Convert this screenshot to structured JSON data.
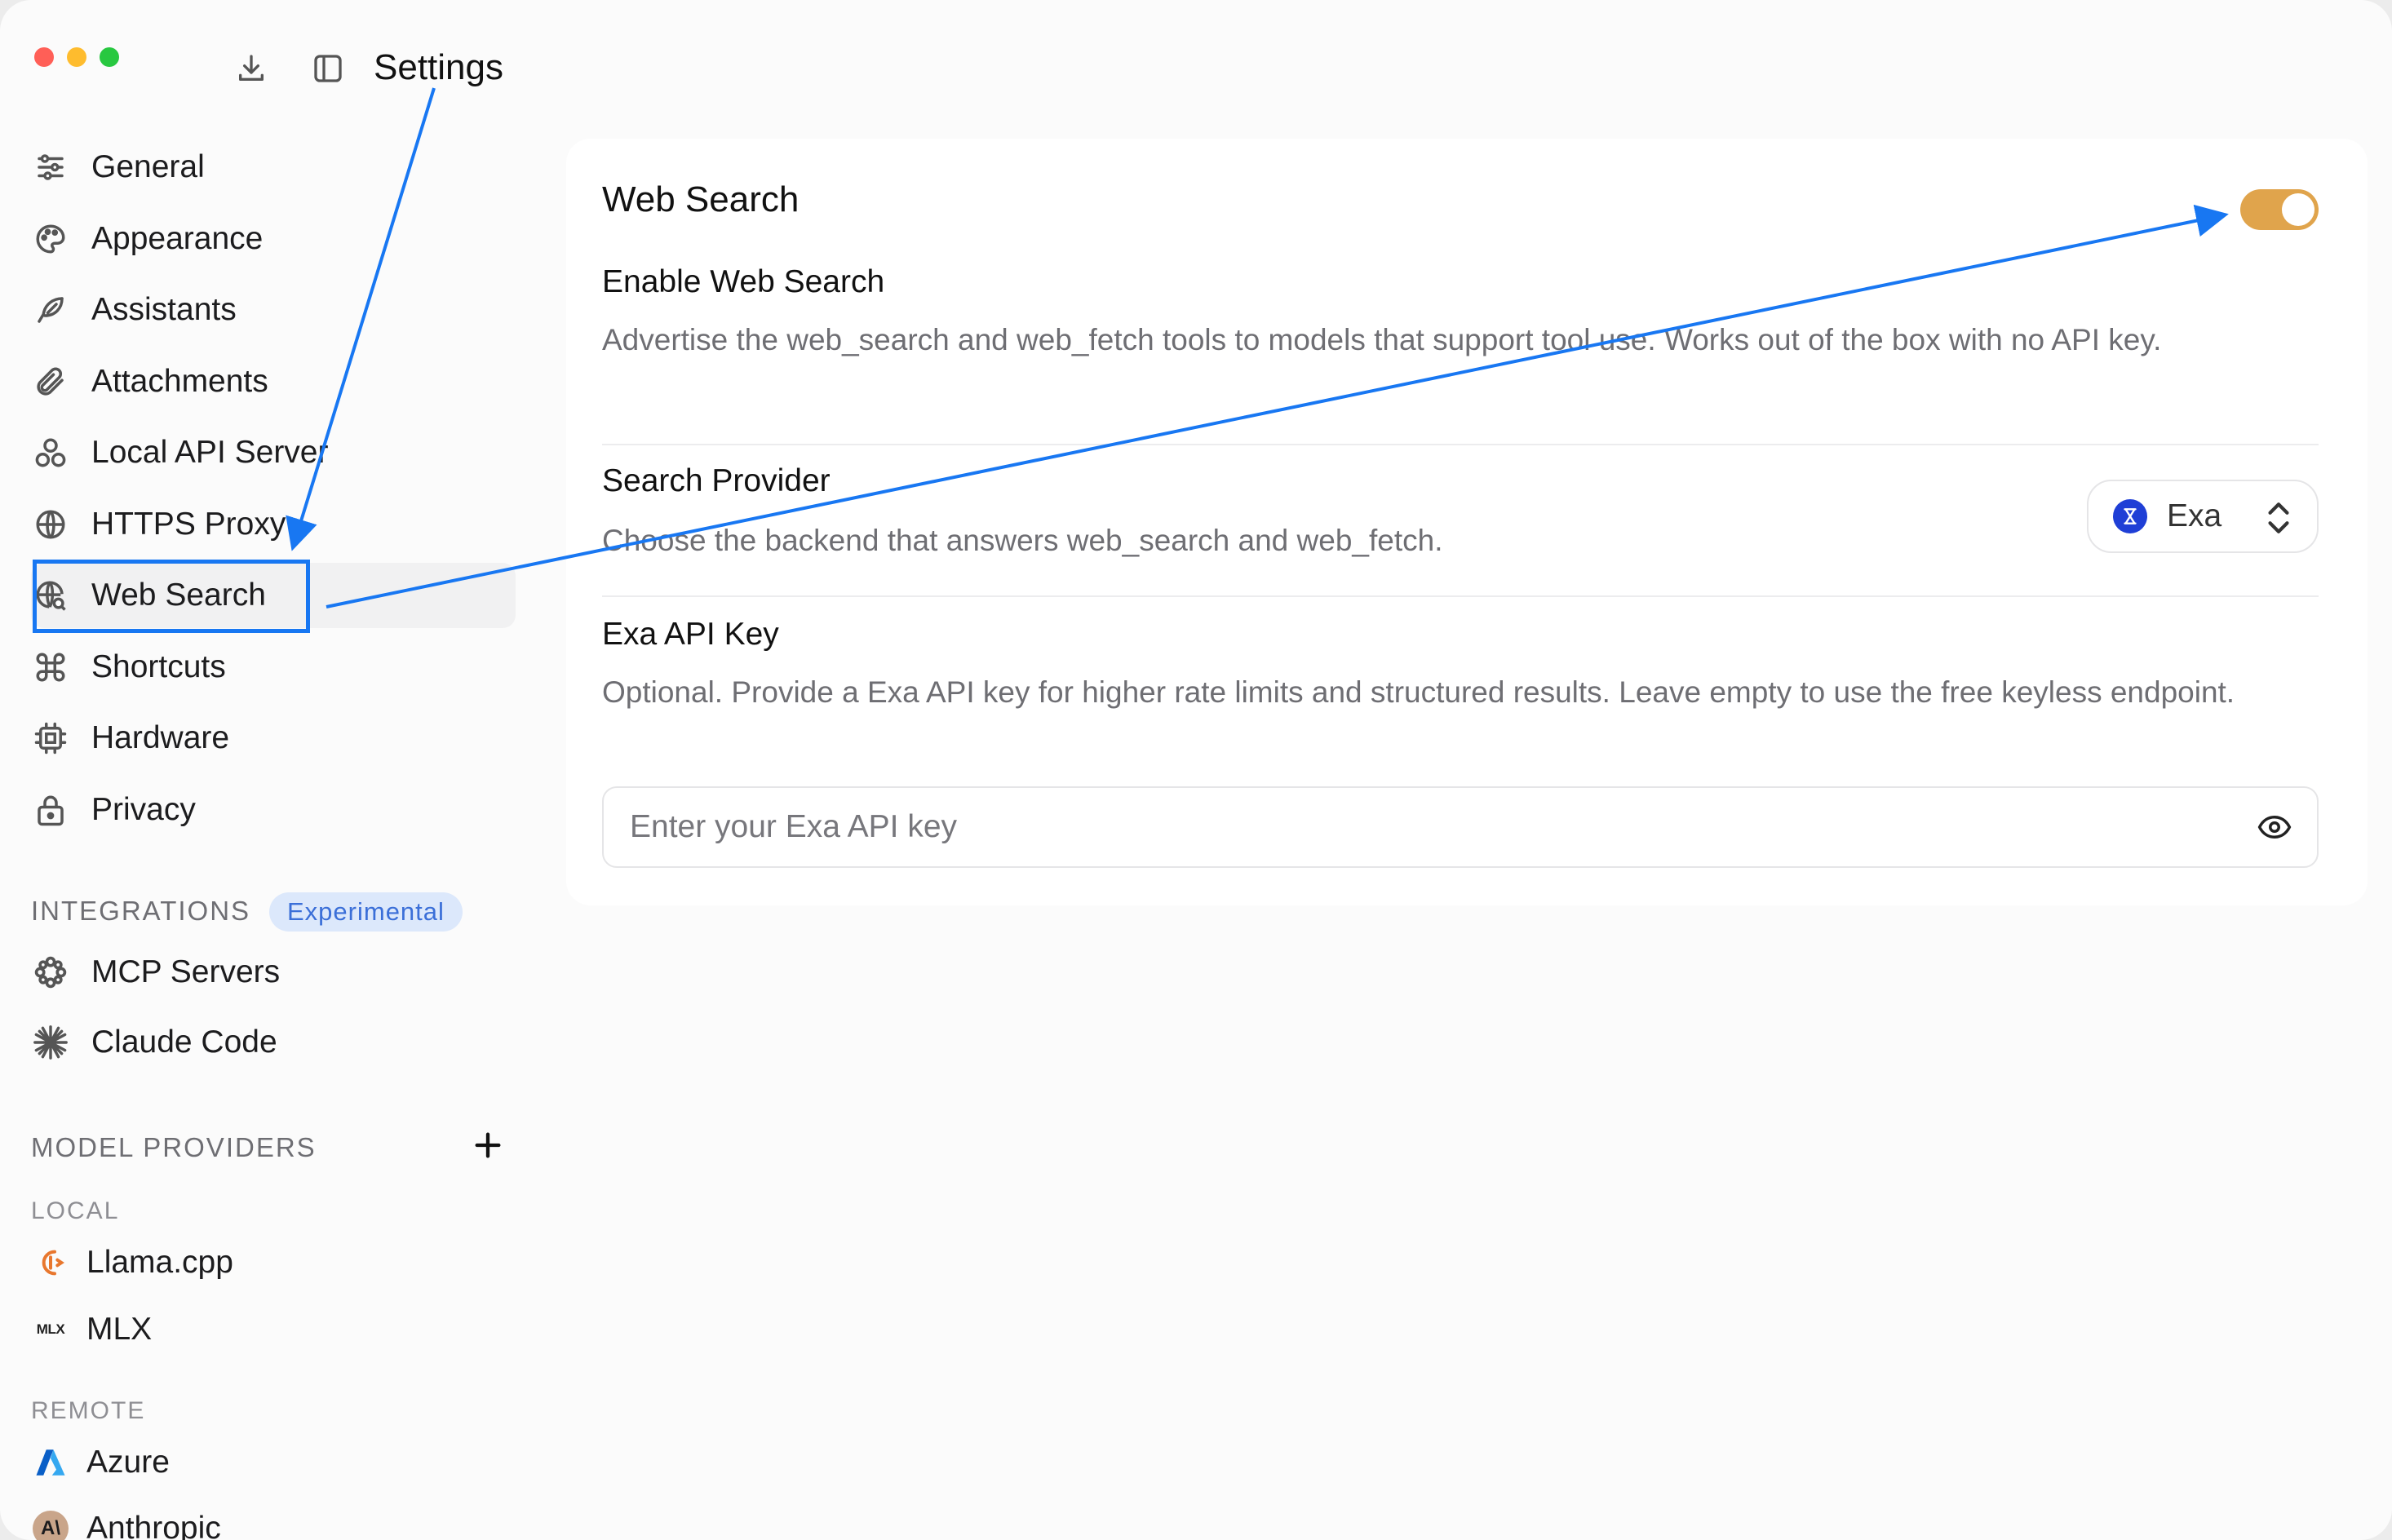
{
  "window": {
    "title": "Settings"
  },
  "sidebar": {
    "items": [
      {
        "id": "general",
        "label": "General",
        "icon": "sliders-icon"
      },
      {
        "id": "appearance",
        "label": "Appearance",
        "icon": "palette-icon"
      },
      {
        "id": "assistants",
        "label": "Assistants",
        "icon": "feather-icon"
      },
      {
        "id": "attachments",
        "label": "Attachments",
        "icon": "paperclip-icon"
      },
      {
        "id": "local-api-server",
        "label": "Local API Server",
        "icon": "nodes-icon"
      },
      {
        "id": "https-proxy",
        "label": "HTTPS Proxy",
        "icon": "globe-icon"
      },
      {
        "id": "web-search",
        "label": "Web Search",
        "icon": "globe-search-icon",
        "active": true
      },
      {
        "id": "shortcuts",
        "label": "Shortcuts",
        "icon": "command-icon"
      },
      {
        "id": "hardware",
        "label": "Hardware",
        "icon": "chip-icon"
      },
      {
        "id": "privacy",
        "label": "Privacy",
        "icon": "lock-icon"
      }
    ],
    "integrations": {
      "label": "INTEGRATIONS",
      "badge": "Experimental",
      "items": [
        {
          "id": "mcp-servers",
          "label": "MCP Servers",
          "icon": "mcp-icon"
        },
        {
          "id": "claude-code",
          "label": "Claude Code",
          "icon": "claude-burst-icon"
        }
      ]
    },
    "model_providers": {
      "label": "MODEL PROVIDERS",
      "local_label": "LOCAL",
      "local": [
        {
          "id": "llama-cpp",
          "label": "Llama.cpp",
          "icon": "llama-icon"
        },
        {
          "id": "mlx",
          "label": "MLX",
          "icon": "mlx-icon",
          "icon_text": "MLX"
        }
      ],
      "remote_label": "REMOTE",
      "remote": [
        {
          "id": "azure",
          "label": "Azure",
          "icon": "azure-icon"
        },
        {
          "id": "anthropic",
          "label": "Anthropic",
          "icon": "anthropic-icon",
          "icon_text": "A\\"
        }
      ]
    }
  },
  "web_search": {
    "title": "Web Search",
    "enabled": true,
    "accent": "#e0a44c",
    "enable": {
      "title": "Enable Web Search",
      "description": "Advertise the web_search and web_fetch tools to models that support tool use. Works out of the box with no API key."
    },
    "provider": {
      "title": "Search Provider",
      "description": "Choose the backend that answers web_search and web_fetch.",
      "selected": "Exa",
      "brand_color": "#1f3fd6"
    },
    "api_key": {
      "title": "Exa API Key",
      "description": "Optional. Provide a Exa API key for higher rate limits and structured results. Leave empty to use the free keyless endpoint.",
      "placeholder": "Enter your Exa API key",
      "value": ""
    }
  },
  "annotation": {
    "color": "#1877f2"
  }
}
